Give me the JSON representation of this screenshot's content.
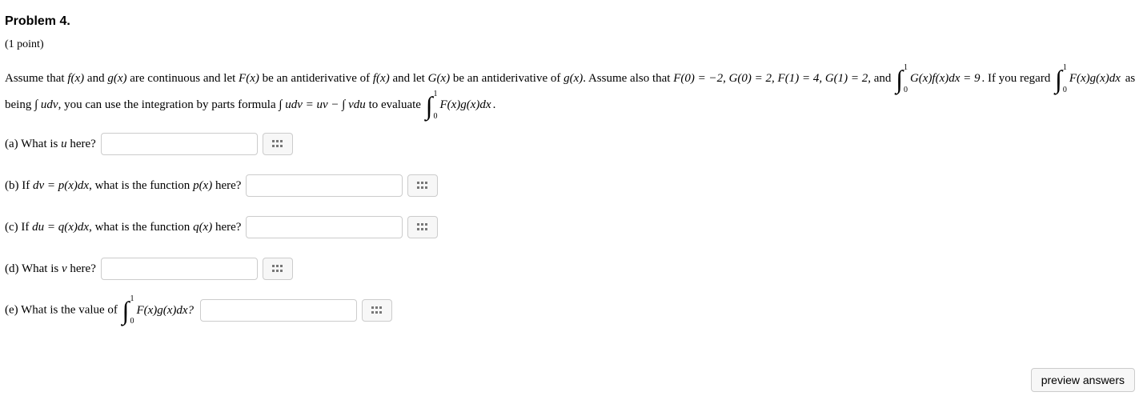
{
  "title": "Problem 4.",
  "points": "(1 point)",
  "text": {
    "seg1a": "Assume that ",
    "fx": "f(x)",
    "seg1b": " and ",
    "gx": "g(x)",
    "seg1c": " are continuous and let ",
    "Fx": "F(x)",
    "seg1d": " be an antiderivative of ",
    "seg1e": " and let ",
    "Gx": "G(x)",
    "seg1f": " be an antiderivative of ",
    "seg1g": ". Assume also that ",
    "eq1": "F(0) = −2, G(0) = 2, F(1) = 4, G(1) = 2, ",
    "seg_and": "and ",
    "int1_up": "1",
    "int1_lo": "0",
    "int1_body": "G(x)f(x)dx = 9",
    "seg2": ". If you regard ",
    "int2_body": "F(x)g(x)dx",
    "seg3": " as being ",
    "udv": "∫ udv",
    "seg4": ", you can use the integration by parts formula ",
    "ibp": "∫ udv = uv − ∫ vdu",
    "seg5": " to evaluate ",
    "int3_body": "F(x)g(x)dx",
    "seg6": "."
  },
  "parts": {
    "a": {
      "pre": "(a) What is ",
      "var": "u",
      "post": " here?"
    },
    "b": {
      "pre": "(b) If ",
      "eq": "dv = p(x)dx",
      "mid": ", what is the function ",
      "fn": "p(x)",
      "post": " here?"
    },
    "c": {
      "pre": "(c) If ",
      "eq": "du = q(x)dx",
      "mid": ", what is the function ",
      "fn": "q(x)",
      "post": " here?"
    },
    "d": {
      "pre": "(d) What is ",
      "var": "v",
      "post": " here?"
    },
    "e": {
      "pre": "(e) What is the value of ",
      "int_up": "1",
      "int_lo": "0",
      "body": "F(x)g(x)dx?",
      "post": ""
    }
  },
  "buttons": {
    "preview": "preview answers"
  },
  "answers": {
    "a": "",
    "b": "",
    "c": "",
    "d": "",
    "e": ""
  }
}
